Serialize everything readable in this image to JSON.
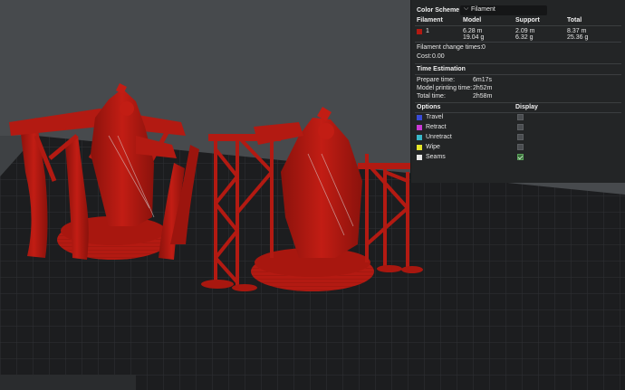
{
  "color_scheme": {
    "title": "Color Scheme",
    "selected": "Filament"
  },
  "filament_table": {
    "headers": [
      "Filament",
      "Model",
      "Support",
      "Total"
    ],
    "row": {
      "id": "1",
      "swatch_color": "#b31a12",
      "model_length": "6.28 m",
      "model_weight": "19.04 g",
      "support_length": "2.09 m",
      "support_weight": "6.32 g",
      "total_length": "8.37 m",
      "total_weight": "25.36 g"
    },
    "change_times_label": "Filament change times:",
    "change_times_value": "0",
    "cost_label": "Cost:",
    "cost_value": "0.00"
  },
  "time_estimation": {
    "title": "Time Estimation",
    "prepare_label": "Prepare time:",
    "prepare_value": "6m17s",
    "model_label": "Model printing time:",
    "model_value": "2h52m",
    "total_label": "Total time:",
    "total_value": "2h58m"
  },
  "options": {
    "title": "Options",
    "display_title": "Display",
    "items": [
      {
        "label": "Travel",
        "color": "#3a4bd6",
        "checked": false
      },
      {
        "label": "Retract",
        "color": "#c93ad6",
        "checked": false
      },
      {
        "label": "Unretract",
        "color": "#3ab8c9",
        "checked": false
      },
      {
        "label": "Wipe",
        "color": "#e6e62a",
        "checked": false
      },
      {
        "label": "Seams",
        "color": "#e8e8e8",
        "checked": true
      }
    ]
  },
  "colors": {
    "print_red": "#b31a12",
    "print_red_dark": "#7c0f0a",
    "plate_grid": "#1c1d1f",
    "plate_line": "#2f3134",
    "background": "#474a4d"
  }
}
